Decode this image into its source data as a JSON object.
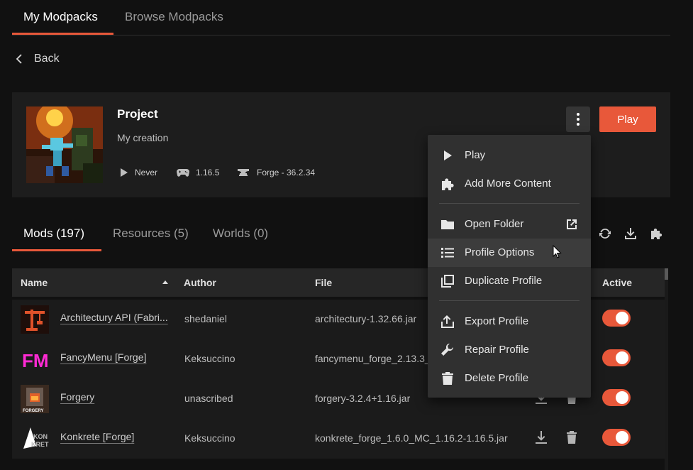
{
  "top_tabs": {
    "my_modpacks": "My Modpacks",
    "browse_modpacks": "Browse Modpacks"
  },
  "back": {
    "label": "Back"
  },
  "project": {
    "title": "Project",
    "description": "My creation",
    "last_played": "Never",
    "game_version": "1.16.5",
    "loader": "Forge - 36.2.34",
    "play_label": "Play"
  },
  "mod_tabs": {
    "mods": "Mods  (197)",
    "resources": "Resources  (5)",
    "worlds": "Worlds  (0)"
  },
  "table": {
    "headers": {
      "name": "Name",
      "author": "Author",
      "file": "File",
      "active": "Active"
    },
    "rows": [
      {
        "name": "Architectury API (Fabri...",
        "author": "shedaniel",
        "file": "architectury-1.32.66.jar"
      },
      {
        "name": "FancyMenu [Forge]",
        "author": "Keksuccino",
        "file": "fancymenu_forge_2.13.3_"
      },
      {
        "name": "Forgery",
        "author": "unascribed",
        "file": "forgery-3.2.4+1.16.jar"
      },
      {
        "name": "Konkrete [Forge]",
        "author": "Keksuccino",
        "file": "konkrete_forge_1.6.0_MC_1.16.2-1.16.5.jar"
      }
    ]
  },
  "menu": {
    "items": [
      {
        "label": "Play",
        "icon": "play-icon"
      },
      {
        "label": "Add More Content",
        "icon": "puzzle-icon"
      },
      {
        "label": "Open Folder",
        "icon": "folder-icon"
      },
      {
        "label": "Profile Options",
        "icon": "list-icon"
      },
      {
        "label": "Duplicate Profile",
        "icon": "copy-icon"
      },
      {
        "label": "Export Profile",
        "icon": "upload-icon"
      },
      {
        "label": "Repair Profile",
        "icon": "wrench-icon"
      },
      {
        "label": "Delete Profile",
        "icon": "trash-icon"
      }
    ]
  },
  "thumb_labels": {
    "forgery": "FORGERY",
    "konkrete_top": "KON",
    "konkrete_bottom": "KRETE",
    "fancymenu": "FM"
  },
  "colors": {
    "accent": "#e8583a",
    "background": "#111111",
    "card": "#1d1d1d",
    "menu": "#303030"
  }
}
